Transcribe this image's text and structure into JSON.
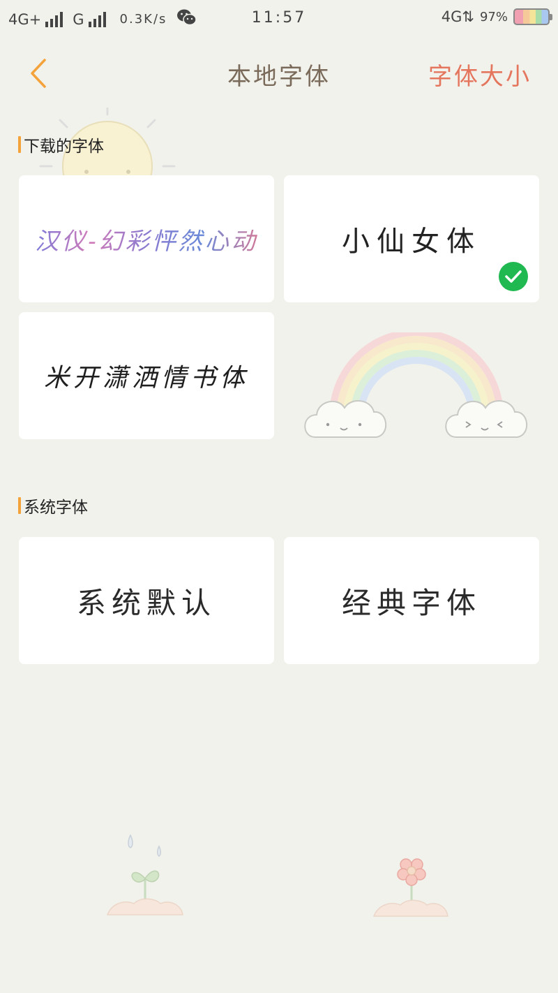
{
  "status_bar": {
    "network_1": "4G+",
    "network_2": "G",
    "speed": "0.3K/s",
    "time": "11:57",
    "network_right": "4G",
    "battery": "97%",
    "wechat_icon": "wechat-icon"
  },
  "header": {
    "back_icon": "chevron-left-icon",
    "title": "本地字体",
    "right_action": "字体大小"
  },
  "sections": {
    "downloaded": {
      "title": "下载的字体",
      "fonts": [
        {
          "label": "汉仪-幻彩怦然心动",
          "selected": false
        },
        {
          "label": "小仙女体",
          "selected": true
        },
        {
          "label": "米开潇洒情书体",
          "selected": false
        }
      ]
    },
    "system": {
      "title": "系统字体",
      "fonts": [
        {
          "label": "系统默认",
          "selected": false
        },
        {
          "label": "经典字体",
          "selected": false
        }
      ]
    }
  },
  "colors": {
    "background": "#f2f2ed",
    "accent": "#f4a23a",
    "title": "#7a6a5a",
    "link": "#e4765e",
    "selected_check": "#1fb851"
  }
}
